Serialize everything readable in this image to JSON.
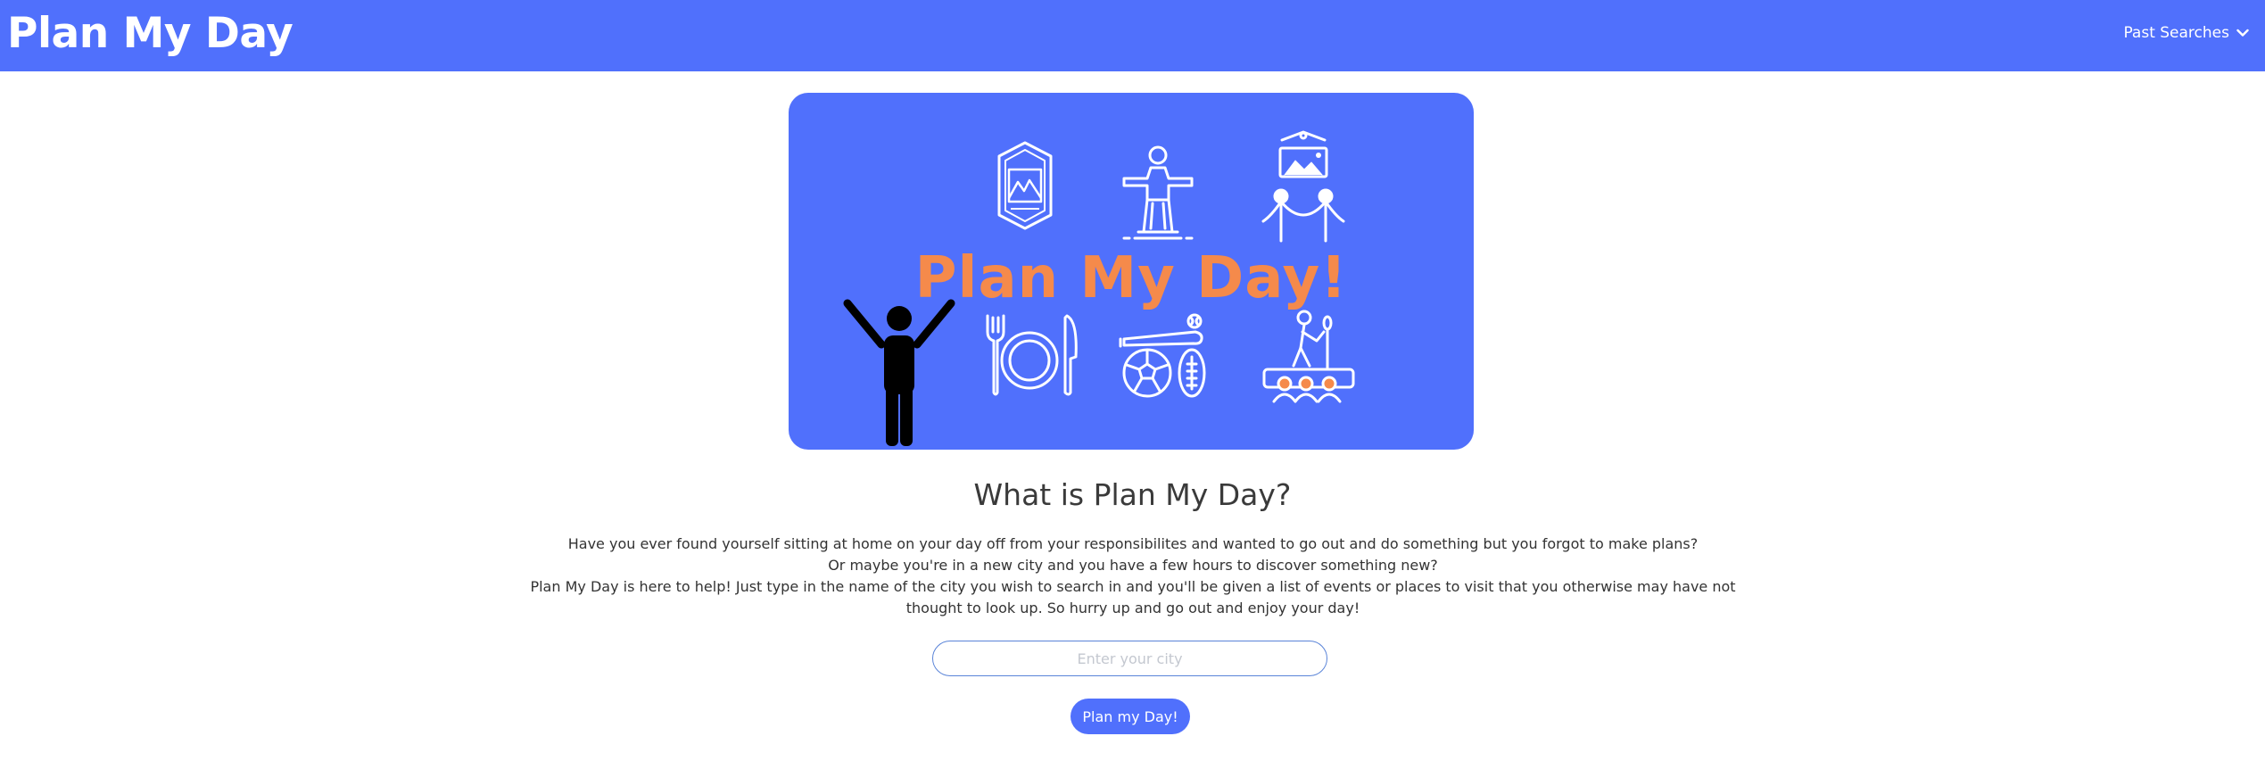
{
  "header": {
    "brand": "Plan My Day",
    "past_searches_label": "Past Searches"
  },
  "hero": {
    "title": "Plan My Day!",
    "icons": [
      "mountain-badge-icon",
      "statue-icon",
      "gallery-icon",
      "person-arms-up-icon",
      "dining-icon",
      "sports-icon",
      "stage-performer-icon"
    ],
    "colors": {
      "background": "#5070fc",
      "title": "#f58a4b",
      "icon": "#ffffff",
      "person": "#000000"
    }
  },
  "main": {
    "heading": "What is Plan My Day?",
    "paragraphs": [
      "Have you ever found yourself sitting at home on your day off from your responsibilites and wanted to go out and do something but you forgot to make plans?",
      "Or maybe you're in a new city and you have a few hours to discover something new?",
      "Plan My Day is here to help! Just type in the name of the city you wish to search in and you'll be given a list of events or places to visit that you otherwise may have not thought to look up. So hurry up and go out and enjoy your day!"
    ]
  },
  "search": {
    "placeholder": "Enter your city",
    "value": "",
    "button_label": "Plan my Day!"
  },
  "colors": {
    "primary": "#5070fc",
    "input_border": "#5a84d8"
  }
}
